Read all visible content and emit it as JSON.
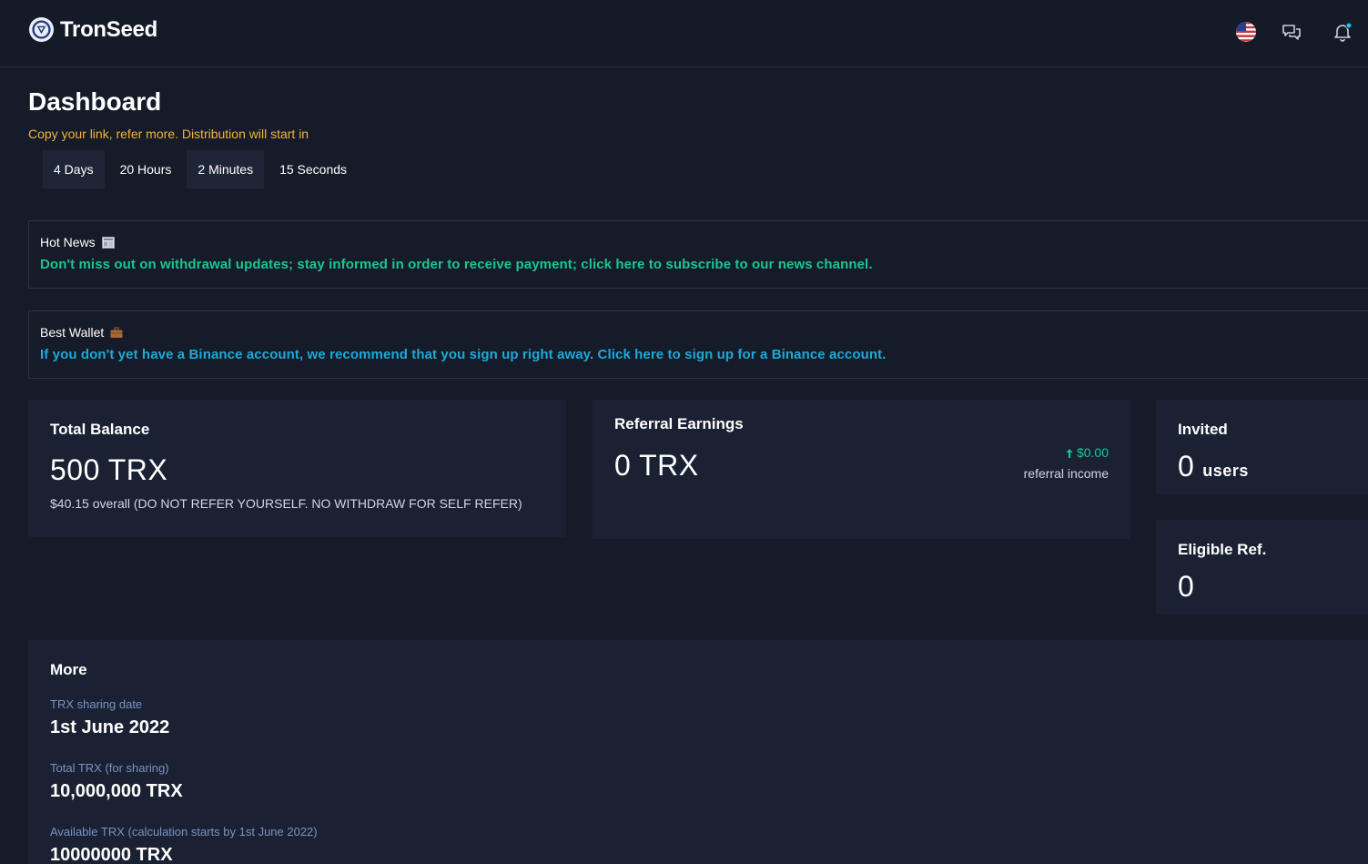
{
  "header": {
    "brand": "TronSeed",
    "icons": [
      "us-flag-icon",
      "chat-icon",
      "bell-icon"
    ]
  },
  "page": {
    "title": "Dashboard",
    "countdown_note": "Copy your link, refer more. Distribution will start in",
    "countdown": [
      "4 Days",
      "20 Hours",
      "2 Minutes",
      "15 Seconds"
    ]
  },
  "banners": {
    "news": {
      "heading": "Hot News",
      "emoji": "newspaper-icon",
      "link": "Don't miss out on withdrawal updates; stay informed in order to receive payment; click here to subscribe to our news channel.",
      "color": "#1cc593"
    },
    "wallet": {
      "heading": "Best Wallet",
      "emoji": "briefcase-icon",
      "link": "If you don't yet have a Binance account, we recommend that you sign up right away. Click here to sign up for a Binance account.",
      "color": "#1ea9d8"
    }
  },
  "cards": {
    "balance": {
      "label": "Total Balance",
      "value": "500 TRX",
      "sub": "$40.15 overall (DO NOT REFER YOURSELF. NO WITHDRAW FOR SELF REFER)"
    },
    "referral": {
      "label": "Referral Earnings",
      "value": "0 TRX",
      "amount": "$0.00",
      "caption": "referral income"
    },
    "invited": {
      "label": "Invited",
      "value": "0",
      "unit": "users"
    },
    "eligible": {
      "label": "Eligible Ref.",
      "value": "0"
    }
  },
  "more": {
    "title": "More",
    "items": [
      {
        "label": "TRX sharing date",
        "value": "1st June 2022"
      },
      {
        "label": "Total TRX (for sharing)",
        "value": "10,000,000 TRX"
      },
      {
        "label": "Available TRX (calculation starts by 1st June 2022)",
        "value": "10000000 TRX"
      }
    ]
  },
  "colors": {
    "background": "#151b28",
    "card": "#1a2132",
    "accent_yellow": "#f0b43c",
    "accent_green": "#1cc593",
    "accent_blue": "#1ea9d8"
  }
}
